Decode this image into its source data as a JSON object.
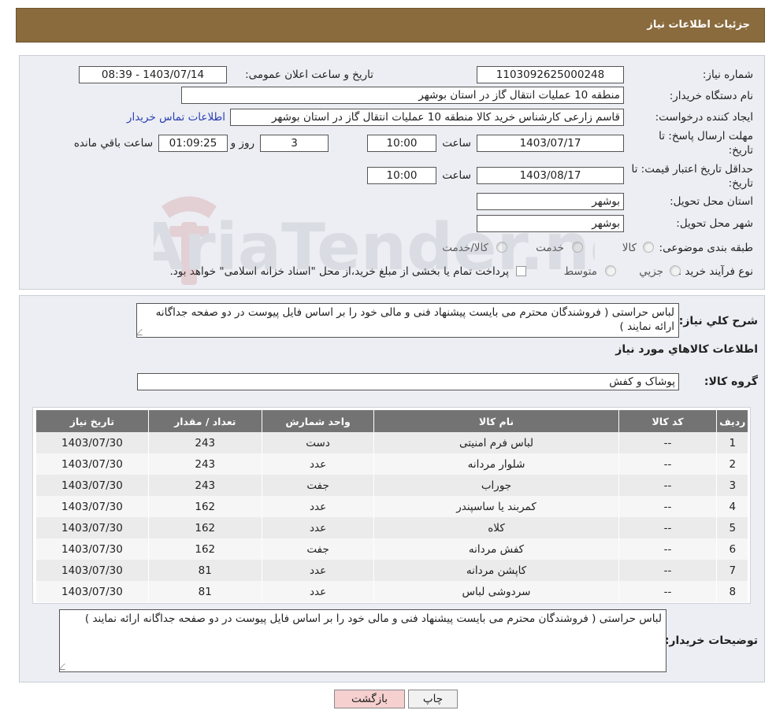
{
  "header": {
    "title": "جزئیات اطلاعات نیاز"
  },
  "form": {
    "need_number_label": "شماره نیاز:",
    "need_number": "1103092625000248",
    "announce_label": "تاریخ و ساعت اعلان عمومی:",
    "announce_value": "1403/07/14 - 08:39",
    "buyer_org_label": "نام دستگاه خریدار:",
    "buyer_org": "منطقه 10 عملیات انتقال گاز در استان بوشهر",
    "creator_label": "ایجاد کننده درخواست:",
    "creator": "قاسم زارعی کارشناس خرید کالا منطقه 10 عملیات انتقال گاز در استان بوشهر",
    "contact_link": "اطلاعات تماس خریدار",
    "deadline_label_1": "مهلت ارسال پاسخ: تا",
    "deadline_label_2": "تاریخ:",
    "deadline_date": "1403/07/17",
    "time_label": "ساعت",
    "deadline_time": "10:00",
    "days_value": "3",
    "days_label": "روز و",
    "remaining_time": "01:09:25",
    "remaining_label": "ساعت باقي مانده",
    "validity_label_1": "حداقل تاریخ اعتبار قیمت: تا",
    "validity_label_2": "تاریخ:",
    "validity_date": "1403/08/17",
    "validity_time": "10:00",
    "province_label": "استان محل تحویل:",
    "province": "بوشهر",
    "city_label": "شهر محل تحویل:",
    "city": "بوشهر",
    "category_label": "طبقه بندی موضوعی:",
    "category_options": [
      "کالا",
      "خدمت",
      "کالا/خدمت"
    ],
    "process_label": "نوع فرآیند خرید :",
    "process_options": [
      "جزیي",
      "متوسط"
    ],
    "payment_note": "پرداخت تمام یا بخشی از مبلغ خرید،از محل \"اسناد خزانه اسلامی\" خواهد بود."
  },
  "description": {
    "label": "شرح کلي نیاز:",
    "text": "لباس حراستی  ( فروشندگان محترم می بایست پیشنهاد فنی و مالی خود را بر اساس فایل پیوست در دو صفحه جداگانه ارائه نمایند )"
  },
  "goods": {
    "section_title": "اطلاعات کالاهاي مورد نیاز",
    "group_label": "گروه کالا:",
    "group_value": "پوشاک و کفش",
    "columns": [
      "ردیف",
      "کد کالا",
      "نام کالا",
      "واحد شمارش",
      "تعداد / مقدار",
      "تاریخ نیاز"
    ],
    "rows": [
      [
        "1",
        "--",
        "لباس فرم امنیتی",
        "دست",
        "243",
        "1403/07/30"
      ],
      [
        "2",
        "--",
        "شلوار مردانه",
        "عدد",
        "243",
        "1403/07/30"
      ],
      [
        "3",
        "--",
        "جوراب",
        "جفت",
        "243",
        "1403/07/30"
      ],
      [
        "4",
        "--",
        "کمربند یا ساسپندر",
        "عدد",
        "162",
        "1403/07/30"
      ],
      [
        "5",
        "--",
        "کلاه",
        "عدد",
        "162",
        "1403/07/30"
      ],
      [
        "6",
        "--",
        "کفش مردانه",
        "جفت",
        "162",
        "1403/07/30"
      ],
      [
        "7",
        "--",
        "کاپشن مردانه",
        "عدد",
        "81",
        "1403/07/30"
      ],
      [
        "8",
        "--",
        "سردوشی لباس",
        "عدد",
        "81",
        "1403/07/30"
      ]
    ]
  },
  "buyer_notes": {
    "label": "توضیحات خریدار:",
    "text": "لباس حراستی  ( فروشندگان محترم می بایست پیشنهاد فنی و مالی خود را بر اساس فایل پیوست در دو صفحه جداگانه ارائه نمایند )"
  },
  "buttons": {
    "print": "چاپ",
    "back": "بازگشت"
  },
  "watermark_text": "AriaTender.neT",
  "colors": {
    "header": "#8a6b3d",
    "panel": "#eceef3",
    "table_header": "#737373",
    "link": "#2a3fb5",
    "back_button": "#f6cfcf"
  }
}
